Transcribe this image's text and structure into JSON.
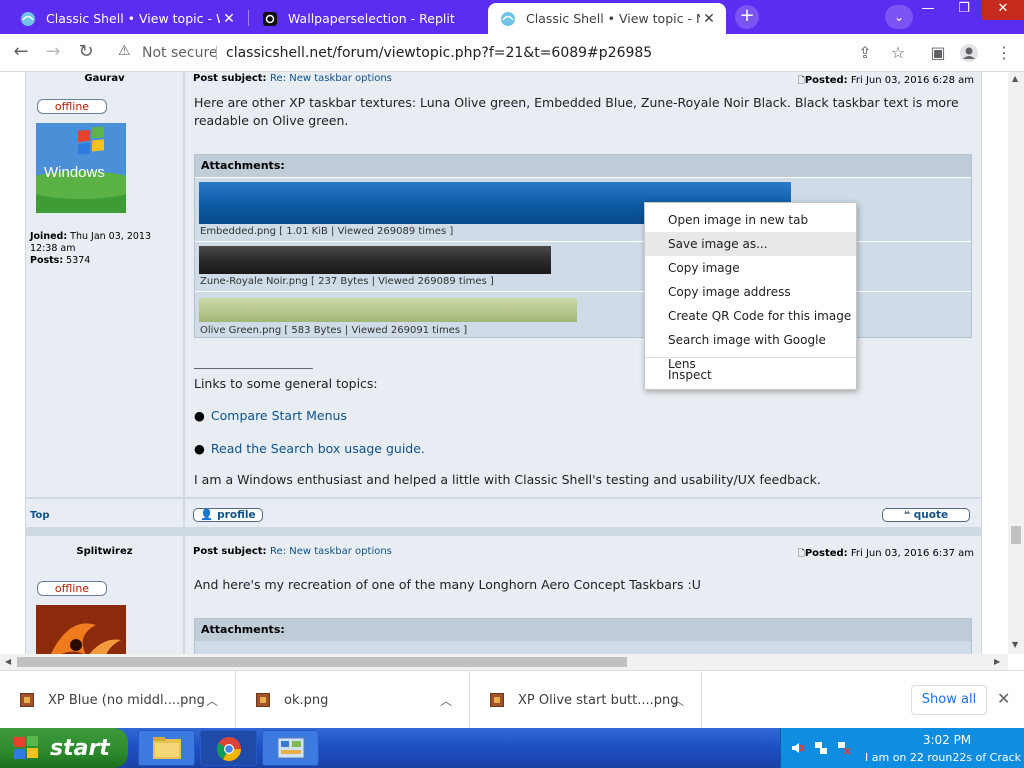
{
  "browser": {
    "tabs": [
      {
        "title": "Classic Shell • View topic - Window",
        "active": false,
        "favicon": "shell-icon"
      },
      {
        "title": "Wallpaperselection - Replit",
        "active": false,
        "favicon": "replit-icon"
      },
      {
        "title": "Classic Shell • View topic - New t",
        "active": true,
        "favicon": "shell-icon"
      }
    ],
    "new_tab_symbol": "+",
    "security_label": "Not secure",
    "url": "classicshell.net/forum/viewtopic.php?f=21&t=6089#p26985"
  },
  "posts": [
    {
      "author": "Gaurav",
      "status": "offline",
      "avatar": "windows-xp-logo",
      "avatar_text": "Windows",
      "joined_label": "Joined:",
      "joined": "Thu Jan 03, 2013 12:38 am",
      "posts_label": "Posts:",
      "posts_count": "5374",
      "subject_label": "Post subject:",
      "subject": "Re: New taskbar options",
      "posted_label": "Posted:",
      "posted": "Fri Jun 03, 2016 6:28 am",
      "body": "Here are other XP taskbar textures: Luna Olive green, Embedded Blue, Zune-Royale Noir Black. Black taskbar text is more readable on Olive green.",
      "attachments_label": "Attachments:",
      "attachments": [
        {
          "caption": "Embedded.png [ 1.01 KiB | Viewed 269089 times ]",
          "color": "#0b5aa3"
        },
        {
          "caption": "Zune-Royale Noir.png [ 237 Bytes | Viewed 269089 times ]",
          "color": "#2b2b2b"
        },
        {
          "caption": "Olive Green.png [ 583 Bytes | Viewed 269091 times ]",
          "color": "#b7c88f"
        }
      ],
      "signature_rule": "___________________",
      "links_intro": "Links to some general topics:",
      "links": [
        "Compare Start Menus",
        "Read the Search box usage guide."
      ],
      "footer_text": "I am a Windows enthusiast and helped a little with Classic Shell's testing and usability/UX feedback.",
      "top_link": "Top",
      "profile_btn": "profile",
      "quote_btn": "quote"
    },
    {
      "author": "Splitwirez",
      "status": "offline",
      "subject_label": "Post subject:",
      "subject": "Re: New taskbar options",
      "posted_label": "Posted:",
      "posted": "Fri Jun 03, 2016 6:37 am",
      "body": "And here's my recreation of one of the many Longhorn Aero Concept Taskbars :U",
      "attachments_label": "Attachments:"
    }
  ],
  "context_menu": {
    "items": [
      "Open image in new tab",
      "Save image as...",
      "Copy image",
      "Copy image address",
      "Create QR Code for this image",
      "Search image with Google Lens"
    ],
    "highlighted_index": 1,
    "inspect": "Inspect"
  },
  "downloads": {
    "items": [
      "XP Blue (no middl....png",
      "ok.png",
      "XP Olive start butt....png"
    ],
    "show_all": "Show all"
  },
  "taskbar": {
    "start_label": "start",
    "clock": "3:02 PM",
    "tray_text": "I am on 22 roun22s of Crack"
  },
  "colors": {
    "tab_strip": "#5b2df0",
    "link": "#105289",
    "offline": "#b51c00",
    "xp_taskbar": "#1e4fc4",
    "xp_start": "#2d8b2d"
  }
}
